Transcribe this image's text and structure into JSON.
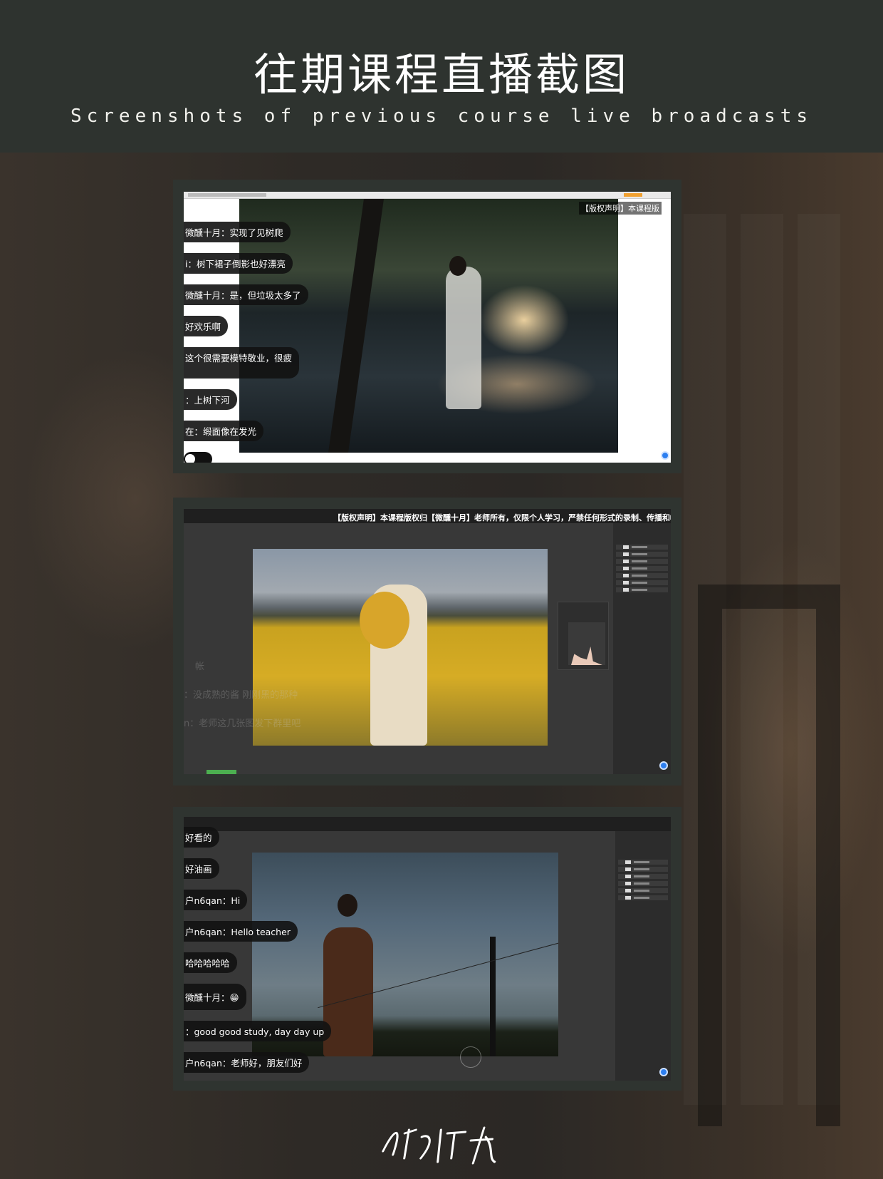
{
  "header": {
    "title": "往期课程直播截图",
    "subtitle": "Screenshots of previous course live broadcasts"
  },
  "screenshot1": {
    "notice": "【版权声明】本课程版",
    "chat": [
      "微醺十月：实现了见树爬",
      "i：树下裙子倒影也好漂亮",
      "微醺十月：是，但垃圾太多了",
      "好欢乐啊",
      "这个很需要模特敬业，很疲",
      "：上树下河",
      "在：缎面像在发光"
    ]
  },
  "screenshot2": {
    "notice": "【版权声明】本课程版权归【微醺十月】老师所有，仅限个人学习，严禁任何形式的录制、传播和帐",
    "faded_chat": [
      "帐",
      "：没成熟的酱 刚刚黑的那种",
      "n：老师这几张图发下群里吧"
    ]
  },
  "screenshot3": {
    "chat": [
      "好看的",
      "好油画",
      "户n6qan：Hi",
      "户n6qan：Hello teacher",
      "哈哈哈哈哈",
      "微醺十月：😁",
      "：good good study, day day up",
      "户n6qan：老师好，朋友们好"
    ]
  },
  "footer": {
    "logo_icon": "signature-logo"
  },
  "colors": {
    "header_bg": "#2e332f",
    "frame_bg": "#2f3430",
    "accent_blue": "#2d7ff0"
  }
}
